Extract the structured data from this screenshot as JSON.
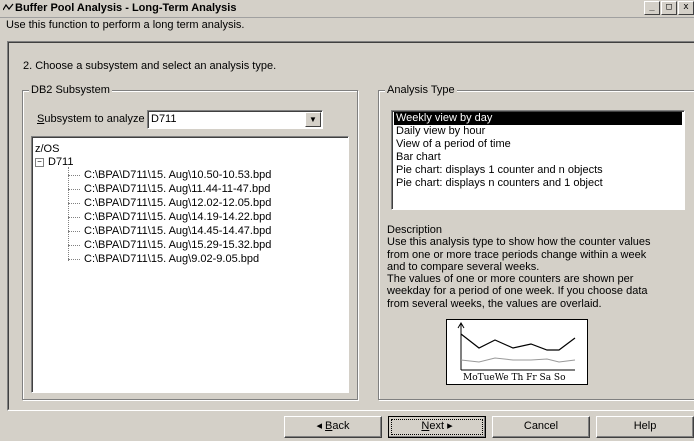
{
  "window": {
    "title": "Buffer Pool Analysis - Long-Term Analysis",
    "controls": [
      "_",
      "□",
      "x"
    ]
  },
  "intro": "Use this function to perform a long term analysis.",
  "step": "2. Choose a subsystem and select an analysis type.",
  "db2_group": {
    "legend": "DB2 Subsystem",
    "subsystem_label_u": "S",
    "subsystem_label_rest": "ubsystem to analyze",
    "subsystem_value": "D711",
    "tree": {
      "root": "z/OS",
      "node": "D711",
      "files": [
        "C:\\BPA\\D711\\15. Aug\\10.50-10.53.bpd",
        "C:\\BPA\\D711\\15. Aug\\11.44-11-47.bpd",
        "C:\\BPA\\D711\\15. Aug\\12.02-12.05.bpd",
        "C:\\BPA\\D711\\15. Aug\\14.19-14.22.bpd",
        "C:\\BPA\\D711\\15. Aug\\14.45-14.47.bpd",
        "C:\\BPA\\D711\\15. Aug\\15.29-15.32.bpd",
        "C:\\BPA\\D711\\15. Aug\\9.02-9.05.bpd"
      ]
    }
  },
  "analysis_group": {
    "legend": "Analysis Type",
    "types": [
      "Weekly view by day",
      "Daily view by hour",
      "View of a period of time",
      "Bar chart",
      "Pie chart: displays 1 counter and n objects",
      "Pie chart: displays n counters and 1 object"
    ],
    "selected_index": 0,
    "description_title": "Description",
    "description_lines": [
      "Use this analysis type to show how the counter values",
      "from one or more trace periods change within a week",
      "and to compare several weeks.",
      "The values of one or more counters are shown per",
      "weekday for a period of one week. If you choose data",
      "from several weeks, the values are overlaid."
    ],
    "preview_days": "MoTueWe Th Fr Sa So"
  },
  "buttons": {
    "back": "Back",
    "back_u": "B",
    "back_rest": "ack",
    "next_u": "N",
    "next_rest": "ext",
    "cancel": "Cancel",
    "help": "Help"
  }
}
